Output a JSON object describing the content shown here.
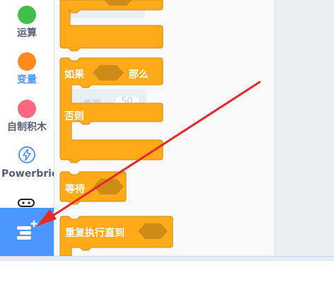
{
  "categories": [
    {
      "label": "运算",
      "color": "#40bf4a"
    },
    {
      "label": "变量",
      "color": "#ff8c1a",
      "active": true
    },
    {
      "label": "自制积木",
      "color": "#ff6680"
    },
    {
      "label": "Powerbrick",
      "color": "#4c97ff"
    }
  ],
  "colors": {
    "block_fill": "#ffab19",
    "block_border": "#cf8b17",
    "accent": "#4c97ff",
    "arrow": "#e8282a"
  },
  "palette": {
    "if_block": {
      "if_label": "如果",
      "then_label": "那么"
    },
    "if_else_block": {
      "else_label": "否则"
    },
    "ghost_text": {
      "angle_label": "角度",
      "angle_value": "50"
    },
    "wait_block": {
      "label": "等待"
    },
    "repeat_until_block": {
      "label": "重复执行直到"
    }
  },
  "extension_button": {
    "icon": "add-extension-icon"
  }
}
